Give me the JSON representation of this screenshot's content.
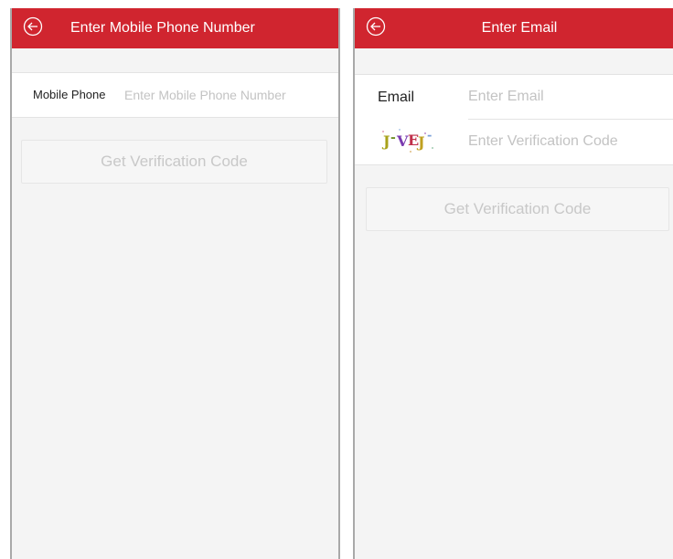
{
  "phone_screen": {
    "title": "Enter Mobile Phone Number",
    "field_label": "Mobile Phone",
    "field_placeholder": "Enter Mobile Phone Number",
    "button_label": "Get Verification Code"
  },
  "email_screen": {
    "title": "Enter Email",
    "email_label": "Email",
    "email_placeholder": "Enter Email",
    "captcha_text": "J-VE-J-",
    "captcha_chars": [
      "J",
      "-",
      "V",
      "E",
      "J",
      "-"
    ],
    "code_placeholder": "Enter Verification Code",
    "button_label": "Get Verification Code"
  },
  "colors": {
    "header": "#d0252f",
    "background": "#f4f4f4",
    "placeholder": "#c3c3c3"
  },
  "icons": [
    "back-arrow-circle-icon"
  ]
}
